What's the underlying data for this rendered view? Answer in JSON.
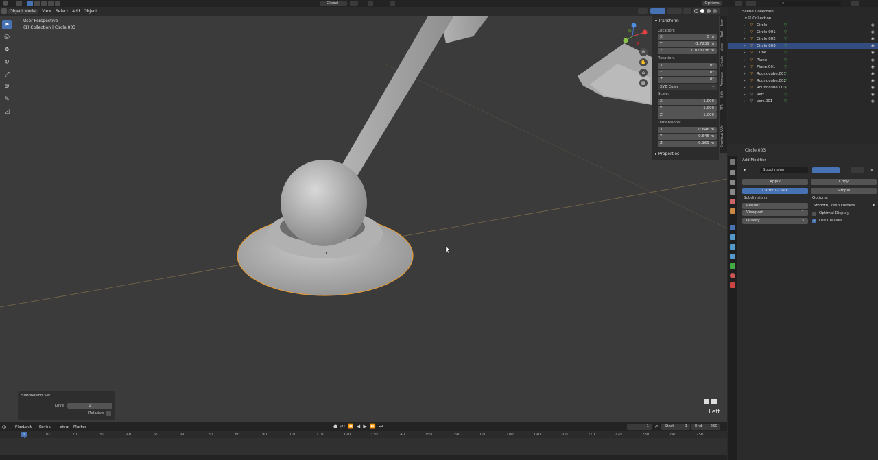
{
  "header": {
    "mode": "Object Mode",
    "menus": [
      "View",
      "Select",
      "Add",
      "Object"
    ],
    "orientation": "Global",
    "options": "Options"
  },
  "viewport": {
    "perspective": "User Perspective",
    "collection_info": "(1) Collection | Circle.003",
    "view_label": "Left"
  },
  "npanel": {
    "transform": "Transform",
    "location_label": "Location:",
    "location": [
      {
        "axis": "X",
        "value": "0 m"
      },
      {
        "axis": "Y",
        "value": "-1.7239 m"
      },
      {
        "axis": "Z",
        "value": "0.013138 m"
      }
    ],
    "rotation_label": "Rotation:",
    "rotation": [
      {
        "axis": "X",
        "value": "0°"
      },
      {
        "axis": "Y",
        "value": "0°"
      },
      {
        "axis": "Z",
        "value": "0°"
      }
    ],
    "rotation_mode": "XYZ Euler",
    "scale_label": "Scale:",
    "scale": [
      {
        "axis": "X",
        "value": "1.000"
      },
      {
        "axis": "Y",
        "value": "1.000"
      },
      {
        "axis": "Z",
        "value": "1.000"
      }
    ],
    "dimensions_label": "Dimensions:",
    "dimensions": [
      {
        "axis": "X",
        "value": "0.646 m"
      },
      {
        "axis": "Y",
        "value": "0.646 m"
      },
      {
        "axis": "Z",
        "value": "0.169 m"
      }
    ],
    "properties": "Properties",
    "tabs": [
      "Item",
      "Tool",
      "View",
      "Create",
      "Animate",
      "Edit",
      "RTN",
      "Shortcut VUr"
    ]
  },
  "outliner": {
    "title": "Scene Collection",
    "collection": "Collection",
    "items": [
      "Circle",
      "Circle.001",
      "Circle.002",
      "Circle.003",
      "Cube",
      "Plane",
      "Plane.001",
      "Roundcube.001",
      "Roundcube.002",
      "Roundcube.003",
      "Vert",
      "Vert.001"
    ],
    "selected_index": 3
  },
  "properties": {
    "object_name": "Circle.003",
    "add_modifier": "Add Modifier",
    "modifier_name": "Subdivision",
    "apply": "Apply",
    "copy": "Copy",
    "catmull": "Catmull-Clark",
    "simple": "Simple",
    "subdivisions": "Subdivisions:",
    "options": "Options:",
    "render_label": "Render",
    "render_value": "1",
    "viewport_label": "Viewport",
    "viewport_value": "1",
    "quality_label": "Quality",
    "quality_value": "3",
    "uv_smooth": "Smooth, keep corners",
    "optimal_display": "Optimal Display",
    "use_creases": "Use Creases"
  },
  "redo_panel": {
    "title": "Subdivision Set",
    "level_label": "Level",
    "level_value": "1",
    "relative_label": "Relative"
  },
  "timeline": {
    "menus": [
      "Playback",
      "Keying",
      "View",
      "Marker"
    ],
    "current_frame": "1",
    "start_label": "Start",
    "start_value": "1",
    "end_label": "End",
    "end_value": "250",
    "ticks": [
      "1",
      "10",
      "20",
      "30",
      "40",
      "50",
      "60",
      "70",
      "80",
      "90",
      "100",
      "110",
      "120",
      "130",
      "140",
      "150",
      "160",
      "170",
      "180",
      "190",
      "200",
      "210",
      "220",
      "230",
      "240",
      "250"
    ]
  },
  "colors": {
    "accent": "#4772b3",
    "selection_outline": "#e69a32",
    "viewport_bg": "#3b3b3b"
  }
}
